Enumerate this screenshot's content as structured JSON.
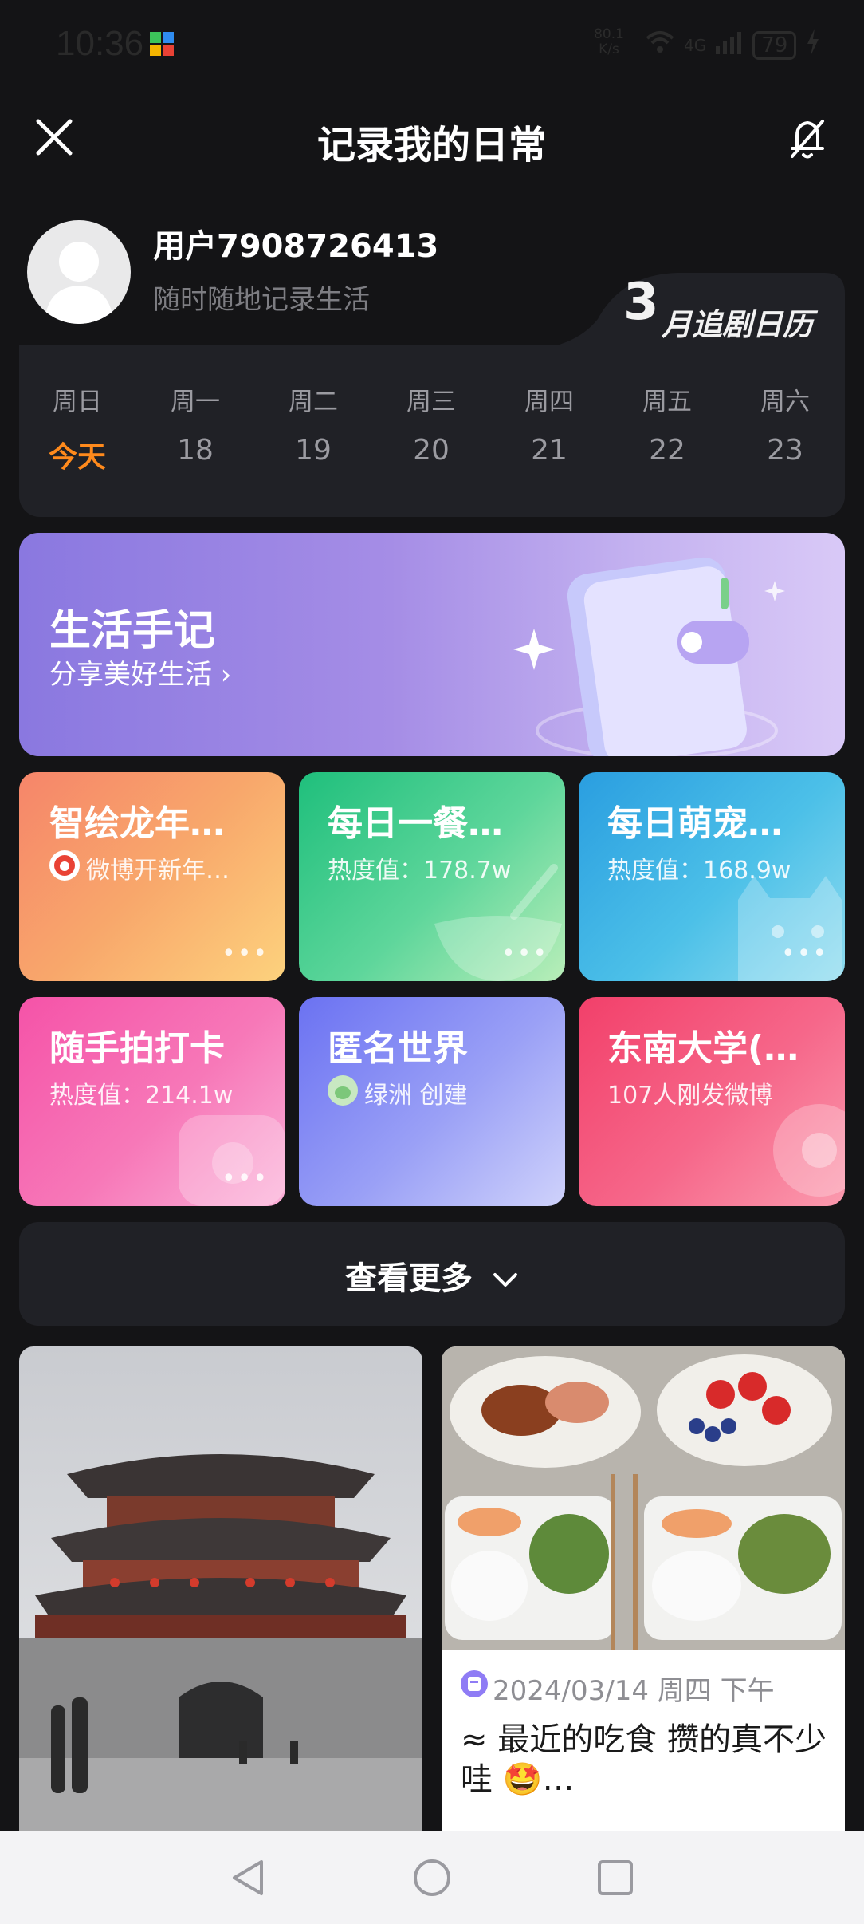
{
  "status_bar": {
    "time": "10:36",
    "speed": "80.1 K/s",
    "signal": "4G",
    "battery": "79"
  },
  "header": {
    "title": "记录我的日常",
    "close_icon": "close-icon",
    "bell_icon": "bell-off-icon"
  },
  "profile": {
    "name": "用户7908726413",
    "subtitle": "随时随地记录生活"
  },
  "calendar": {
    "month_num": "3",
    "month_label": "月追剧日历",
    "days": [
      {
        "weekday": "周日",
        "date": "今天"
      },
      {
        "weekday": "周一",
        "date": "18"
      },
      {
        "weekday": "周二",
        "date": "19"
      },
      {
        "weekday": "周三",
        "date": "20"
      },
      {
        "weekday": "周四",
        "date": "21"
      },
      {
        "weekday": "周五",
        "date": "22"
      },
      {
        "weekday": "周六",
        "date": "23"
      }
    ]
  },
  "banner": {
    "title": "生活手记",
    "subtitle": "分享美好生活 ›"
  },
  "topics": [
    {
      "title": "智绘龙年…",
      "sub": "微博开新年…",
      "more": "•••"
    },
    {
      "title": "每日一餐…",
      "sub": "热度值：178.7w",
      "more": "•••"
    },
    {
      "title": "每日萌宠…",
      "sub": "热度值：168.9w",
      "more": "•••"
    },
    {
      "title": "随手拍打卡",
      "sub": "热度值：214.1w",
      "more": "•••"
    },
    {
      "title": "匿名世界",
      "sub": "绿洲 创建",
      "more": ""
    },
    {
      "title": "东南大学(…",
      "sub": "107人刚发微博",
      "more": ""
    }
  ],
  "see_more": {
    "label": "查看更多"
  },
  "feed": {
    "right_post": {
      "date": "2024/03/14 周四 下午",
      "text": "≈ 最近的吃食 攒的真不少哇 🤩…"
    }
  },
  "colors": {
    "accent": "#ff8a1c",
    "bg": "#141416",
    "card": "#202126"
  }
}
